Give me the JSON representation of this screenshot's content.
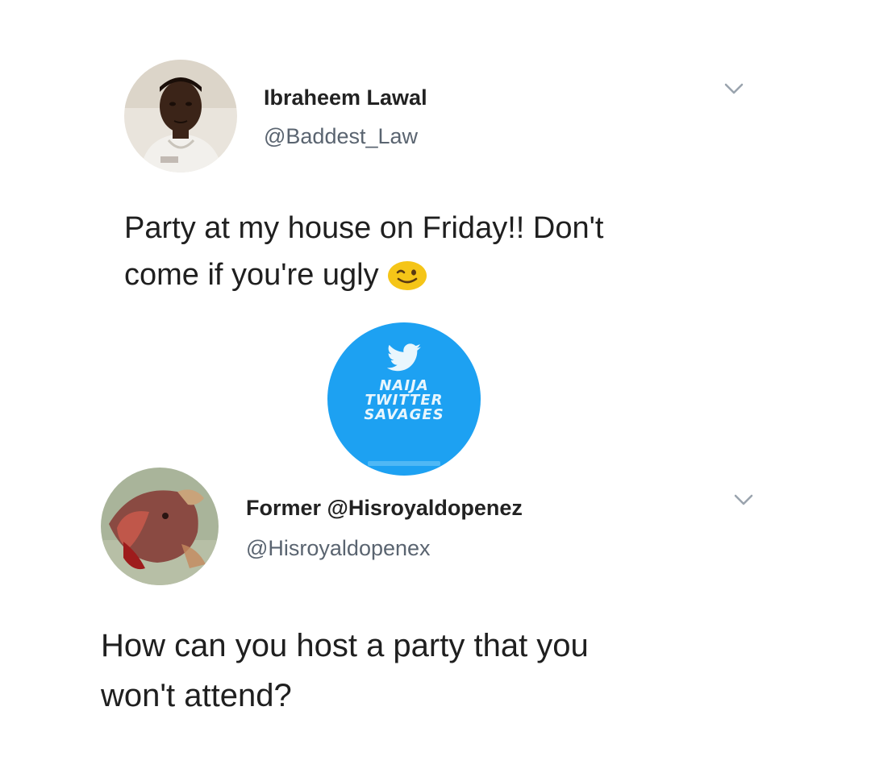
{
  "tweet1": {
    "display_name": "Ibraheem Lawal",
    "handle": "@Baddest_Law",
    "text_line1": "Party at my house on Friday!! Don't",
    "text_line2": "come if you're ugly",
    "emoji": "winking-face",
    "menu_icon": "chevron-down-icon"
  },
  "watermark": {
    "line1": "NAIJA",
    "line2": "TWITTER",
    "line3": "SAVAGES",
    "colors": {
      "background": "#1da1f2",
      "text": "#e9f6fd"
    }
  },
  "tweet2": {
    "display_name": "Former @Hisroyaldopenez",
    "handle": "@Hisroyaldopenex",
    "text_line1": "How can you host a party that you",
    "text_line2": "won't attend?",
    "menu_icon": "chevron-down-icon"
  },
  "colors": {
    "handle": "#5a6470",
    "chevron": "#9aa4ae",
    "emoji": "#f5c518"
  }
}
